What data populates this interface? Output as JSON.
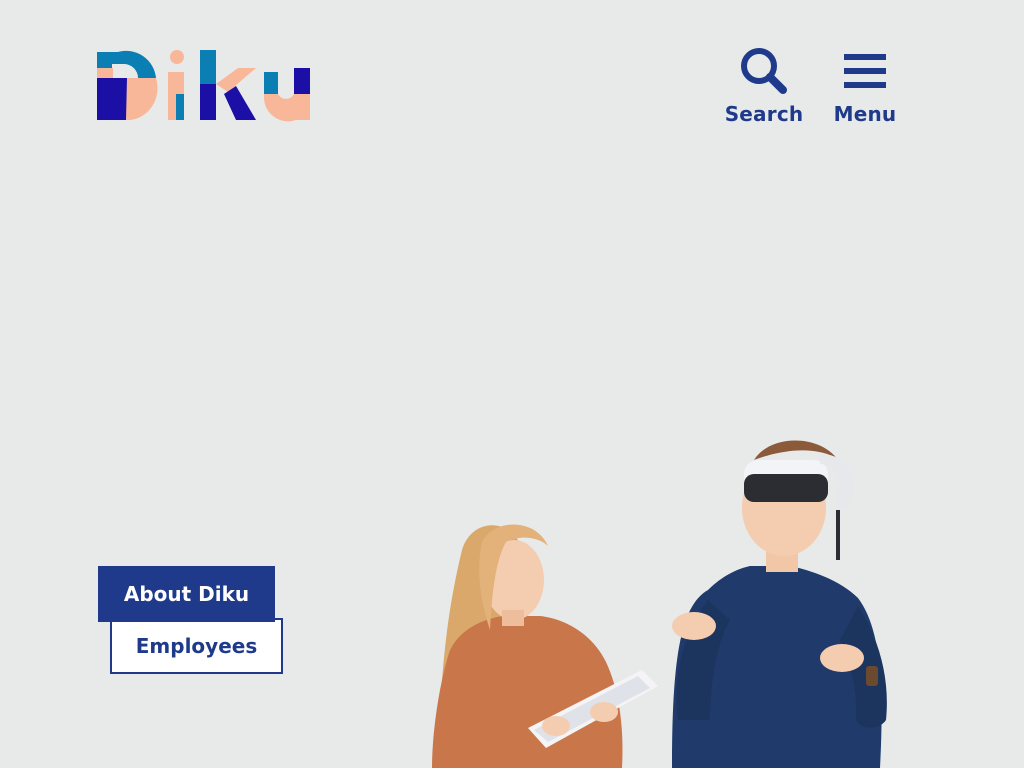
{
  "logo": {
    "text": "Diku",
    "colors": {
      "navy": "#1c0fa6",
      "teal": "#0b7fb3",
      "peach": "#f9b79a"
    }
  },
  "header": {
    "search_label": "Search",
    "menu_label": "Menu",
    "search_icon": "search-icon",
    "menu_icon": "hamburger-menu-icon"
  },
  "links": {
    "about_label": "About Diku",
    "employees_label": "Employees"
  },
  "colors": {
    "background": "#e8eaea",
    "accent": "#1f3a8a",
    "button_text_inverse": "#ffffff"
  }
}
